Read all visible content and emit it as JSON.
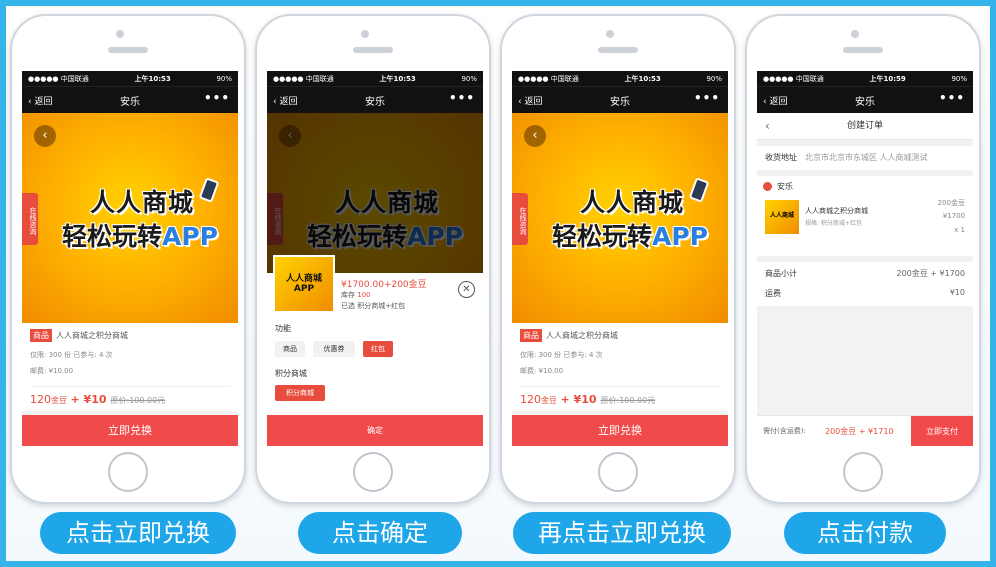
{
  "status": {
    "carrier": "●●●●● 中国联通",
    "battery": "90%"
  },
  "nav": {
    "back": "返回",
    "title": "安乐",
    "more": "•••"
  },
  "banner": {
    "line1": "人人商城",
    "line2a": "轻松玩转",
    "line2b": "APP",
    "side_tag": "在线咨询",
    "back_icon": "‹"
  },
  "product": {
    "tag": "商品",
    "name": "人人商城之积分商城",
    "limit": "仅限: 300 份 已参与: 4 次",
    "postage": "邮费: ¥10.00",
    "price_coins": "120",
    "coin_unit": "金豆",
    "price_cash": "+ ¥10",
    "orig_price": "原价:100.00元",
    "exchange_btn": "立即兑换"
  },
  "screens": [
    {
      "time": "上午10:53"
    },
    {
      "time": "上午10:53"
    },
    {
      "time": "上午10:53"
    },
    {
      "time": "上午10:59"
    }
  ],
  "sheet": {
    "price": "¥1700.00+200金豆",
    "stock_label": "库存",
    "stock_value": "100",
    "picked": "已选  积分商城+红包",
    "group1": "功能",
    "opt1": "商品",
    "opt2": "优惠券",
    "opt3": "红包",
    "group2": "积分商城",
    "opt4": "积分商城",
    "confirm": "确定",
    "close_icon": "✕"
  },
  "order": {
    "title": "创建订单",
    "addr_label": "收货地址",
    "addr_value": "北京市北京市东城区  人人商城测试",
    "shop": "安乐",
    "item_name": "人人商城之积分商城",
    "item_spec": "规格: 积分商城+红包",
    "item_coins": "200金豆",
    "item_cash": "¥1700",
    "item_qty": "x 1",
    "subtotal_label": "商品小计",
    "subtotal_value": "200金豆 + ¥1700",
    "freight_label": "运费",
    "freight_value": "¥10",
    "pay_label": "需付(含运费):",
    "pay_amount": "200金豆 + ¥1710",
    "pay_btn": "立即支付"
  },
  "captions": [
    "点击立即兑换",
    "点击确定",
    "再点击立即兑换",
    "点击付款"
  ],
  "colors": {
    "accent": "#f04a4a",
    "caption_bg": "#1ea6e8",
    "border": "#35b4ec"
  }
}
